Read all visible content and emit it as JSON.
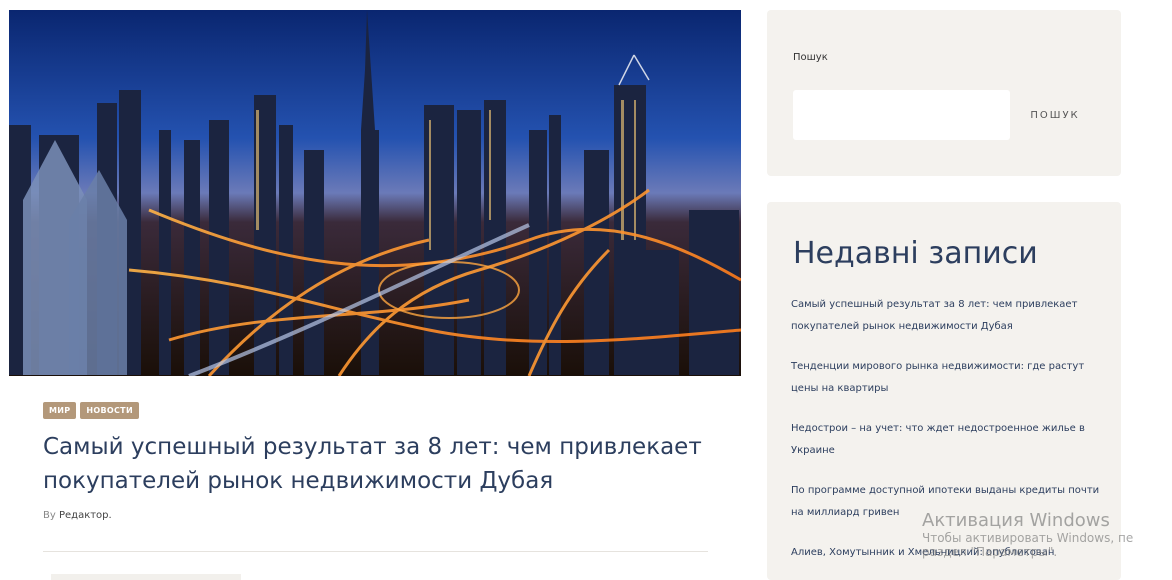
{
  "article": {
    "categories": [
      "МИР",
      "НОВОСТИ"
    ],
    "title": "Самый успешный результат за 8 лет: чем привлекает покупателей рынок недвижимости Дубая",
    "byline_prefix": "By",
    "author": "Редактор."
  },
  "sidebar": {
    "search": {
      "label": "Пошук",
      "placeholder": "",
      "button_label": "ПОШУК"
    },
    "recent": {
      "title": "Недавні записи",
      "items": [
        "Самый успешный результат за 8 лет: чем привлекает покупателей рынок недвижимости Дубая",
        "Тенденции мирового рынка недвижимости: где растут цены на квартиры",
        "Недострои – на учет: что ждет недостроенное жилье в Украине",
        "По программе доступной ипотеки выданы кредиты почти на миллиард гривен",
        "Алиев, Хомутынник и Хмельницкий: опубликован"
      ]
    }
  },
  "watermark": {
    "title": "Активация Windows",
    "line1": "Чтобы активировать Windows, пе",
    "line2": "раздел \"Параметры\"."
  },
  "colors": {
    "accent_navy": "#2c3e5e",
    "category_tag": "#b3987a",
    "widget_bg": "#f4f2ee"
  }
}
